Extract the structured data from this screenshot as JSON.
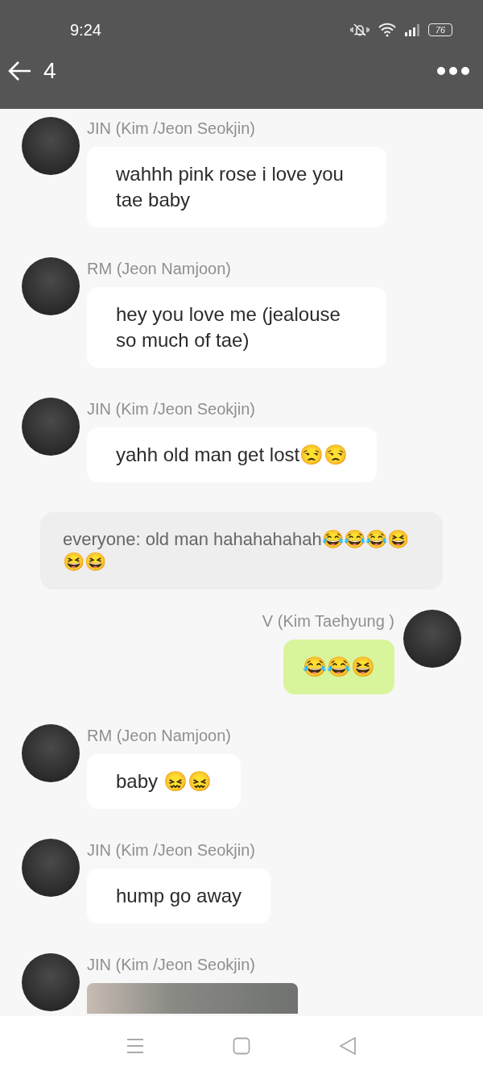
{
  "status_bar": {
    "time": "9:24",
    "battery": "76"
  },
  "header": {
    "count": "4"
  },
  "messages": [
    {
      "kind": "incoming",
      "sender": "JIN (Kim /Jeon Seokjin)",
      "text": "wahhh pink rose i love you tae baby"
    },
    {
      "kind": "incoming",
      "sender": "RM (Jeon Namjoon)",
      "text": "hey you love me (jealouse so much of tae)"
    },
    {
      "kind": "incoming",
      "sender": "JIN (Kim /Jeon Seokjin)",
      "text": "yahh old man get lost😒😒"
    },
    {
      "kind": "system",
      "text": "everyone: old man hahahahahah😂😂😂😆😆😆"
    },
    {
      "kind": "outgoing",
      "sender": "V (Kim Taehyung )",
      "text": "😂😂😆"
    },
    {
      "kind": "incoming",
      "sender": "RM (Jeon Namjoon)",
      "text": "baby 😖😖"
    },
    {
      "kind": "incoming",
      "sender": "JIN (Kim /Jeon Seokjin)",
      "text": "hump go away"
    },
    {
      "kind": "incoming_photo",
      "sender": "JIN (Kim /Jeon Seokjin)"
    }
  ]
}
